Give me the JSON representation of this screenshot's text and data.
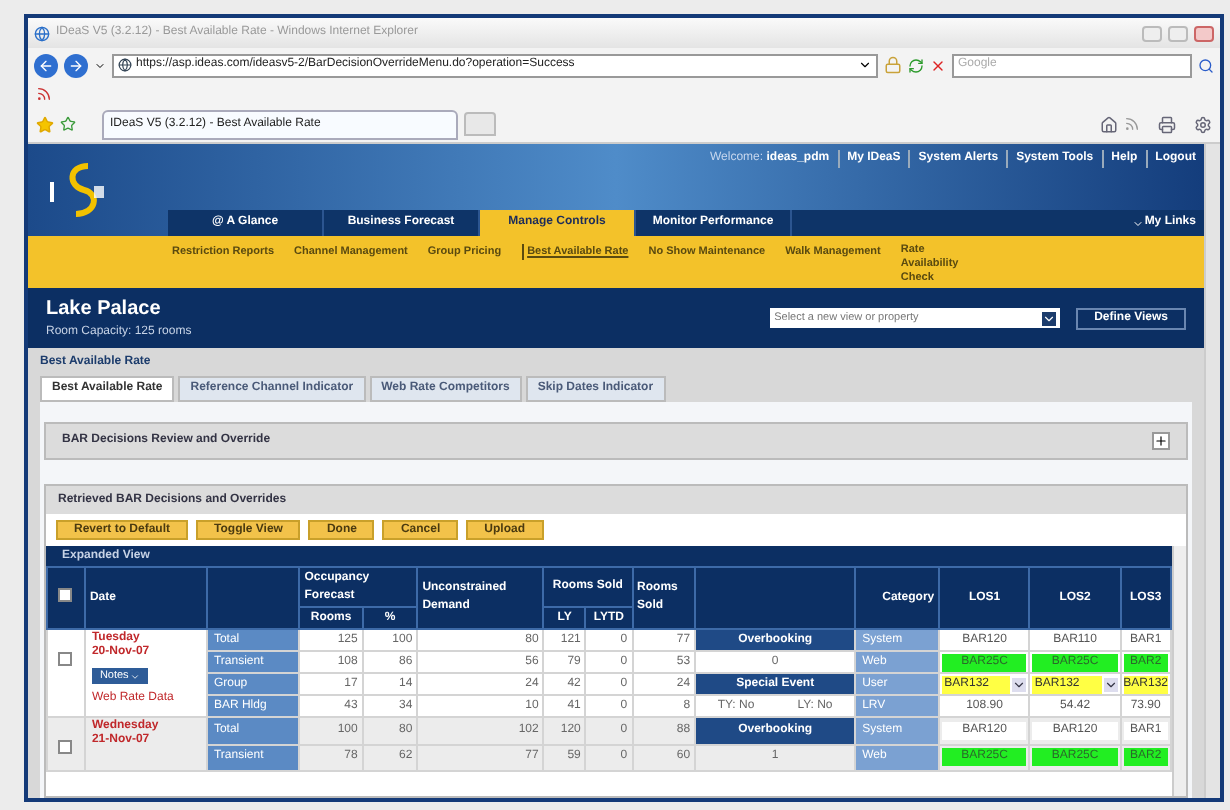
{
  "browser": {
    "title": "IDeaS V5 (3.2.12) - Best Available Rate - Windows Internet Explorer",
    "url": "https://asp.ideas.com/ideasv5-2/BarDecisionOverrideMenu.do?operation=Success",
    "search_placeholder": "Google",
    "tab_title": "IDeaS V5 (3.2.12) - Best Available Rate"
  },
  "header": {
    "welcome": "Welcome:",
    "user": "ideas_pdm",
    "links": [
      "My IDeaS",
      "System Alerts",
      "System Tools",
      "Help",
      "Logout"
    ],
    "my_links": "My Links"
  },
  "nav": [
    {
      "label": "@ A Glance",
      "selected": false
    },
    {
      "label": "Business Forecast",
      "selected": false
    },
    {
      "label": "Manage Controls",
      "selected": true
    },
    {
      "label": "Monitor Performance",
      "selected": false
    }
  ],
  "subnav": [
    {
      "label": "Restriction Reports",
      "selected": false
    },
    {
      "label": "Channel Management",
      "selected": false
    },
    {
      "label": "Group Pricing",
      "selected": false
    },
    {
      "label": "Best Available Rate",
      "selected": true
    },
    {
      "label": "No Show Maintenance",
      "selected": false
    },
    {
      "label": "Walk Management",
      "selected": false
    },
    {
      "label": "Rate Availability Check",
      "selected": false
    }
  ],
  "property": {
    "name": "Lake Palace",
    "capacity": "Room Capacity: 125 rooms",
    "view_placeholder": "Select a new view or property",
    "define_views": "Define Views"
  },
  "section_title": "Best Available Rate",
  "tabs": [
    {
      "label": "Best Available Rate",
      "selected": true
    },
    {
      "label": "Reference Channel Indicator",
      "selected": false
    },
    {
      "label": "Web Rate Competitors",
      "selected": false
    },
    {
      "label": "Skip Dates Indicator",
      "selected": false
    }
  ],
  "review_panel": {
    "title": "BAR Decisions Review and Override",
    "expanded": false
  },
  "retrieved_panel": {
    "title": "Retrieved BAR Decisions and Overrides",
    "buttons": [
      "Revert to Default",
      "Toggle View",
      "Done",
      "Cancel",
      "Upload"
    ],
    "view_label": "Expanded View"
  },
  "table": {
    "select_all_checked": false,
    "columns": {
      "date": "Date",
      "occupancy": "Occupancy Forecast",
      "rooms": "Rooms",
      "percent": "%",
      "demand": "Unconstrained Demand",
      "sold_group": "Rooms Sold",
      "ly": "LY",
      "lytd": "LYTD",
      "rooms_sold": "Rooms Sold",
      "category": "Category",
      "los": [
        "LOS1",
        "LOS2",
        "LOS3"
      ]
    },
    "dates": [
      {
        "day": "Tuesday",
        "date": "20-Nov-07",
        "checked": false,
        "notes": "Notes",
        "link": "Web Rate Data",
        "rows": [
          {
            "segment": "Total",
            "rooms": "125",
            "percent": "100",
            "demand": "80",
            "ly": "121",
            "lytd": "0",
            "sold": "77",
            "special": {
              "kind": "label",
              "texts": [
                "Overbooking"
              ]
            },
            "category": "System",
            "los": [
              {
                "text": "BAR120",
                "kind": "plain"
              },
              {
                "text": "BAR110",
                "kind": "plain"
              },
              {
                "text": "BAR1",
                "kind": "plain"
              }
            ]
          },
          {
            "segment": "Transient",
            "rooms": "108",
            "percent": "86",
            "demand": "56",
            "ly": "79",
            "lytd": "0",
            "sold": "53",
            "special": {
              "kind": "value",
              "texts": [
                "0"
              ]
            },
            "category": "Web",
            "los": [
              {
                "text": "BAR25C",
                "kind": "web"
              },
              {
                "text": "BAR25C",
                "kind": "web"
              },
              {
                "text": "BAR2",
                "kind": "web"
              }
            ]
          },
          {
            "segment": "Group",
            "rooms": "17",
            "percent": "14",
            "demand": "24",
            "ly": "42",
            "lytd": "0",
            "sold": "24",
            "special": {
              "kind": "label",
              "texts": [
                "Special Event"
              ]
            },
            "category": "User",
            "los": [
              {
                "text": "BAR132",
                "kind": "select"
              },
              {
                "text": "BAR132",
                "kind": "select"
              },
              {
                "text": "BAR132",
                "kind": "user"
              }
            ]
          },
          {
            "segment": "BAR Hldg",
            "rooms": "43",
            "percent": "34",
            "demand": "10",
            "ly": "41",
            "lytd": "0",
            "sold": "8",
            "special": {
              "kind": "value",
              "texts": [
                "TY: No",
                "LY: No"
              ]
            },
            "category": "LRV",
            "los": [
              {
                "text": "108.90",
                "kind": "plain"
              },
              {
                "text": "54.42",
                "kind": "plain"
              },
              {
                "text": "73.90",
                "kind": "plain"
              }
            ]
          }
        ]
      },
      {
        "day": "Wednesday",
        "date": "21-Nov-07",
        "checked": false,
        "rows": [
          {
            "segment": "Total",
            "rooms": "100",
            "percent": "80",
            "demand": "102",
            "ly": "120",
            "lytd": "0",
            "sold": "88",
            "special": {
              "kind": "label",
              "texts": [
                "Overbooking"
              ]
            },
            "category": "System",
            "los": [
              {
                "text": "BAR120",
                "kind": "plain"
              },
              {
                "text": "BAR120",
                "kind": "plain"
              },
              {
                "text": "BAR1",
                "kind": "plain"
              }
            ]
          },
          {
            "segment": "Transient",
            "rooms": "78",
            "percent": "62",
            "demand": "77",
            "ly": "59",
            "lytd": "0",
            "sold": "60",
            "special": {
              "kind": "value",
              "texts": [
                "1"
              ]
            },
            "category": "Web",
            "los": [
              {
                "text": "BAR25C",
                "kind": "web"
              },
              {
                "text": "BAR25C",
                "kind": "web"
              },
              {
                "text": "BAR2",
                "kind": "web"
              }
            ]
          }
        ]
      }
    ]
  }
}
